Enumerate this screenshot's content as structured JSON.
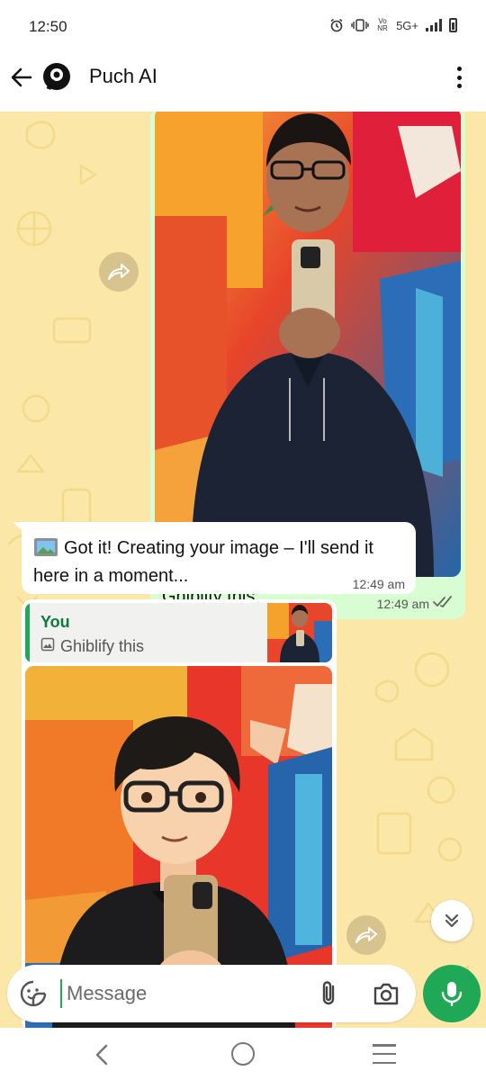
{
  "status": {
    "time": "12:50",
    "network": "5G+",
    "volte": "Vo NR"
  },
  "header": {
    "title": "Puch AI",
    "back_icon": "arrow-left-icon",
    "avatar_icon": "puch-logo-icon",
    "menu_icon": "more-vertical-icon"
  },
  "messages": [
    {
      "direction": "outgoing",
      "type": "image",
      "caption": "Ghiblify this",
      "time": "12:49 am",
      "status_icon": "double-check-icon"
    },
    {
      "direction": "incoming",
      "type": "text",
      "emoji_icon": "framed-picture-icon",
      "text": "Got it! Creating your image – I'll send it here in a moment...",
      "time": "12:49 am"
    },
    {
      "direction": "incoming",
      "type": "image",
      "quote": {
        "author": "You",
        "text": "Ghiblify this",
        "icon": "image-icon"
      }
    }
  ],
  "composer": {
    "placeholder": "Message",
    "sticker_icon": "sticker-icon",
    "attach_icon": "paperclip-icon",
    "camera_icon": "camera-icon",
    "mic_icon": "mic-icon"
  },
  "colors": {
    "chat_background": "#fbe7a8",
    "outgoing_bubble": "#d8fdd2",
    "incoming_bubble": "#ffffff",
    "accent_green": "#1fa855",
    "quote_author": "#0e7a3c"
  }
}
